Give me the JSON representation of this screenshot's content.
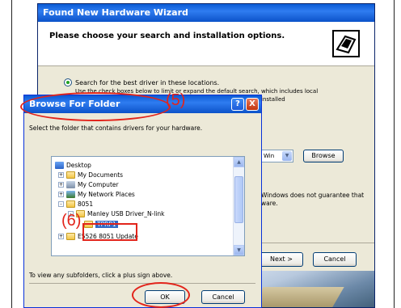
{
  "wizard": {
    "title": "Found New Hardware Wizard",
    "heading": "Please choose your search and installation options.",
    "radio_option": "Search for the best driver in these locations.",
    "sub_text_1": "Use the check boxes below to limit or expand the default search, which includes local",
    "sub_text_2": "installed",
    "combo_value": "Win",
    "browse_label": "Browse",
    "warning_text": "Windows does not guarantee that ware.",
    "next_label": "Next >",
    "cancel_label": "Cancel"
  },
  "dialog": {
    "title": "Browse For Folder",
    "help_glyph": "?",
    "close_glyph": "X",
    "instruction": "Select the folder that contains drivers for your hardware.",
    "tree": [
      {
        "label": "Desktop",
        "icon": "desktop-icon",
        "expander": ""
      },
      {
        "label": "My Documents",
        "icon": "folder-icon",
        "expander": "+"
      },
      {
        "label": "My Computer",
        "icon": "computer-icon",
        "expander": "+"
      },
      {
        "label": "My Network Places",
        "icon": "network-icon",
        "expander": "+"
      },
      {
        "label": "8051",
        "icon": "folder-icon",
        "expander": "-"
      },
      {
        "label": "Manley USB Driver_N-link",
        "icon": "folder-icon",
        "expander": "-"
      },
      {
        "label": "TPRP1",
        "icon": "folder-icon",
        "expander": "",
        "selected": true
      },
      {
        "label": "E5526 8051 Update",
        "icon": "folder-icon",
        "expander": "+"
      }
    ],
    "hint": "To view any subfolders, click a plus sign above.",
    "ok_label": "OK",
    "cancel_label": "Cancel"
  },
  "annotations": {
    "label_5": "(5)",
    "label_6": "(6)",
    "color": "#e2241b"
  }
}
